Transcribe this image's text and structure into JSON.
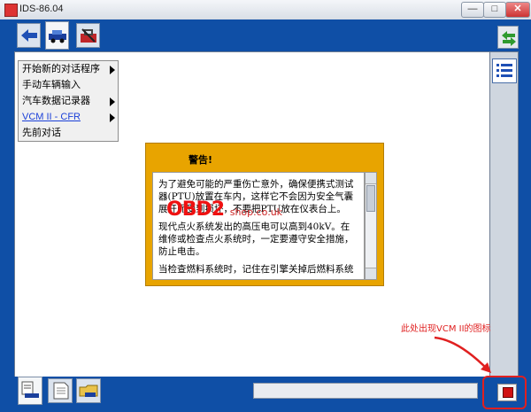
{
  "window": {
    "title": "IDS-86.04",
    "min_label": "—",
    "max_label": "□",
    "close_label": "✕"
  },
  "menu": {
    "items": [
      {
        "label": "开始新的对话程序",
        "has_submenu": true
      },
      {
        "label": "手动车辆输入",
        "has_submenu": false
      },
      {
        "label": "汽车数据记录器",
        "has_submenu": true
      },
      {
        "label": "VCM II - CFR",
        "has_submenu": true
      },
      {
        "label": "先前对话",
        "has_submenu": false
      }
    ]
  },
  "warning": {
    "title": "警告!",
    "paragraphs": [
      "为了避免可能的严重伤亡意外，确保便携式测试器(PTU)放置在车内，这样它不会因为安全气囊展开而受到损坏，不要把PTU放在仪表台上。",
      "现代点火系统发出的高压电可以高到40kV。在维修或检查点火系统时，一定要遵守安全措施，防止电击。",
      "当检查燃料系统时，记住在引擎关掉后燃料系统"
    ]
  },
  "watermark": {
    "text": "OBD2",
    "domain": "shop.co.uk"
  },
  "annotation": {
    "text": "此处出现VCM II的图标"
  },
  "status": {
    "value": ""
  },
  "icons": {
    "toolbar": [
      "back-arrow-icon",
      "vehicle-icon",
      "toolbox-icon"
    ],
    "sidebar": [
      "swap-arrows-icon",
      "list-icon"
    ],
    "bottom": [
      "vehicle-info-icon",
      "document-icon",
      "folder-vehicle-icon",
      "vcm-ii-icon"
    ]
  },
  "colors": {
    "frame": "#0f4fa6",
    "warning": "#e8a400",
    "annotation": "#e02020"
  }
}
